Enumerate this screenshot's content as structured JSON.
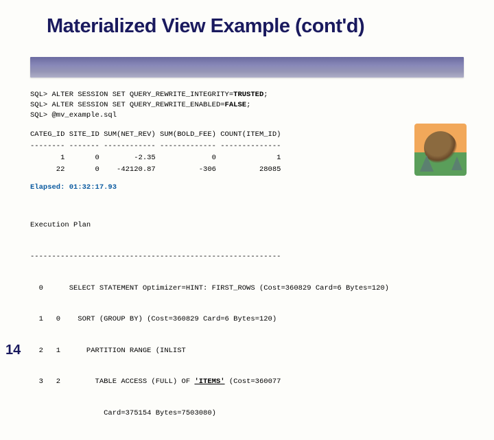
{
  "title": "Materialized View Example (cont'd)",
  "page_number": "14",
  "sql": {
    "line1_a": "SQL> ALTER SESSION SET QUERY_REWRITE_INTEGRITY=",
    "line1_b": "TRUSTED",
    "line1_c": ";",
    "line2_a": "SQL> ALTER SESSION SET QUERY_REWRITE_ENABLED=",
    "line2_b": "FALSE",
    "line2_c": ";",
    "line3": "SQL> @mv_example.sql"
  },
  "table": {
    "header": "CATEG_ID SITE_ID SUM(NET_REV) SUM(BOLD_FEE) COUNT(ITEM_ID)",
    "sep": "-------- ------- ------------ ------------- --------------",
    "row1": "       1       0        -2.35             0              1",
    "row2": "      22       0    -42120.87          -306          28085"
  },
  "elapsed_label": "Elapsed: ",
  "elapsed_value": "01:32:17.93",
  "plan": {
    "heading": "Execution Plan",
    "sep": "----------------------------------------------------------",
    "l0": "  0      SELECT STATEMENT Optimizer=HINT: FIRST_ROWS (Cost=360829 Card=6 Bytes=120)",
    "l1": "  1   0    SORT (GROUP BY) (Cost=360829 Card=6 Bytes=120)",
    "l2": "  2   1      PARTITION RANGE (INLIST",
    "l3a": "  3   2        TABLE ACCESS (FULL) OF ",
    "l3b": "'ITEMS'",
    "l3c": " (Cost=360077",
    "l4": "                 Card=375154 Bytes=7503080)"
  }
}
